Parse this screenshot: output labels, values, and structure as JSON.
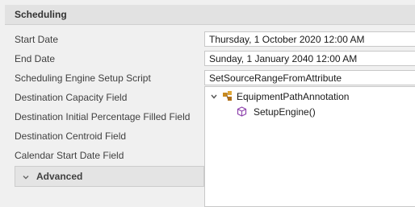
{
  "section": {
    "title": "Scheduling"
  },
  "fields": [
    {
      "label": "Start Date",
      "value": "Thursday, 1 October 2020 12:00 AM"
    },
    {
      "label": "End Date",
      "value": "Sunday, 1 January 2040 12:00 AM"
    },
    {
      "label": "Scheduling Engine Setup Script",
      "value": "SetSourceRangeFromAttribute"
    },
    {
      "label": "Destination Capacity Field"
    },
    {
      "label": "Destination Initial Percentage Filled Field"
    },
    {
      "label": "Destination Centroid Field"
    },
    {
      "label": "Calendar Start Date Field"
    }
  ],
  "dropdown": {
    "parent_label": "EquipmentPathAnnotation",
    "child_label": "SetupEngine()",
    "parent_icon": "class-icon",
    "child_icon": "method-cube-icon"
  },
  "advanced": {
    "label": "Advanced"
  },
  "colors": {
    "class_icon": "#c98a1f",
    "method_icon": "#8e44ad"
  }
}
